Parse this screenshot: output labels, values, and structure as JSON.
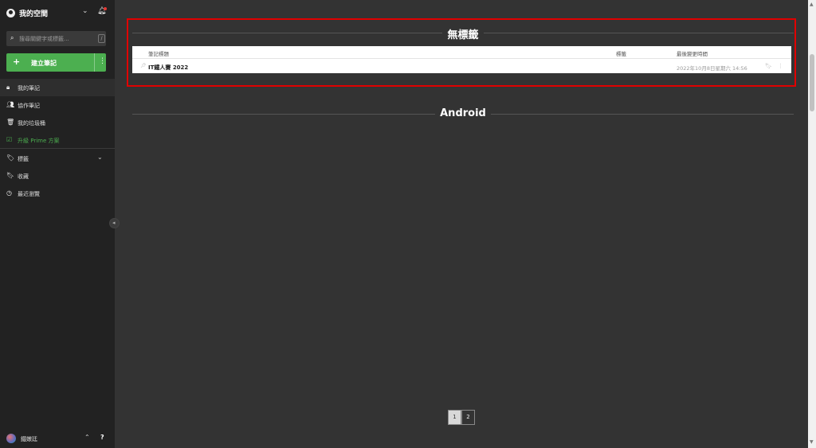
{
  "sidebar": {
    "title": "我的空間",
    "search": {
      "placeholder": "搜尋關鍵字或標籤...",
      "shortcut": "/"
    },
    "new_note": {
      "label": "建立筆記",
      "more": "⋮"
    },
    "items": [
      {
        "label": "我的筆記",
        "icon": "lock-icon"
      },
      {
        "label": "協作筆記",
        "icon": "users-icon"
      },
      {
        "label": "我的垃圾桶",
        "icon": "trash-icon"
      },
      {
        "label": "升級 Prime 方案",
        "icon": "prime-icon"
      },
      {
        "label": "標籤",
        "icon": "tag-icon"
      },
      {
        "label": "收藏",
        "icon": "bookmark-icon"
      },
      {
        "label": "最近瀏覽",
        "icon": "clock-icon"
      }
    ],
    "user": {
      "name": "鐵嫩廷"
    },
    "help": "?"
  },
  "main": {
    "sections": [
      {
        "title": "無標籤",
        "columns": [
          "筆記標題",
          "標籤",
          "最後變更時間"
        ],
        "rows": [
          {
            "title": "IT鐵人賽 2022",
            "tags": "",
            "time": "2022年10月8日星期六 14:56"
          }
        ]
      },
      {
        "title": "Android"
      }
    ],
    "pagination": [
      "1",
      "2"
    ],
    "current_page": "1"
  },
  "colors": {
    "accent": "#4caf50",
    "highlight": "#e00000",
    "background": "#333333",
    "sidebar": "#222222"
  }
}
